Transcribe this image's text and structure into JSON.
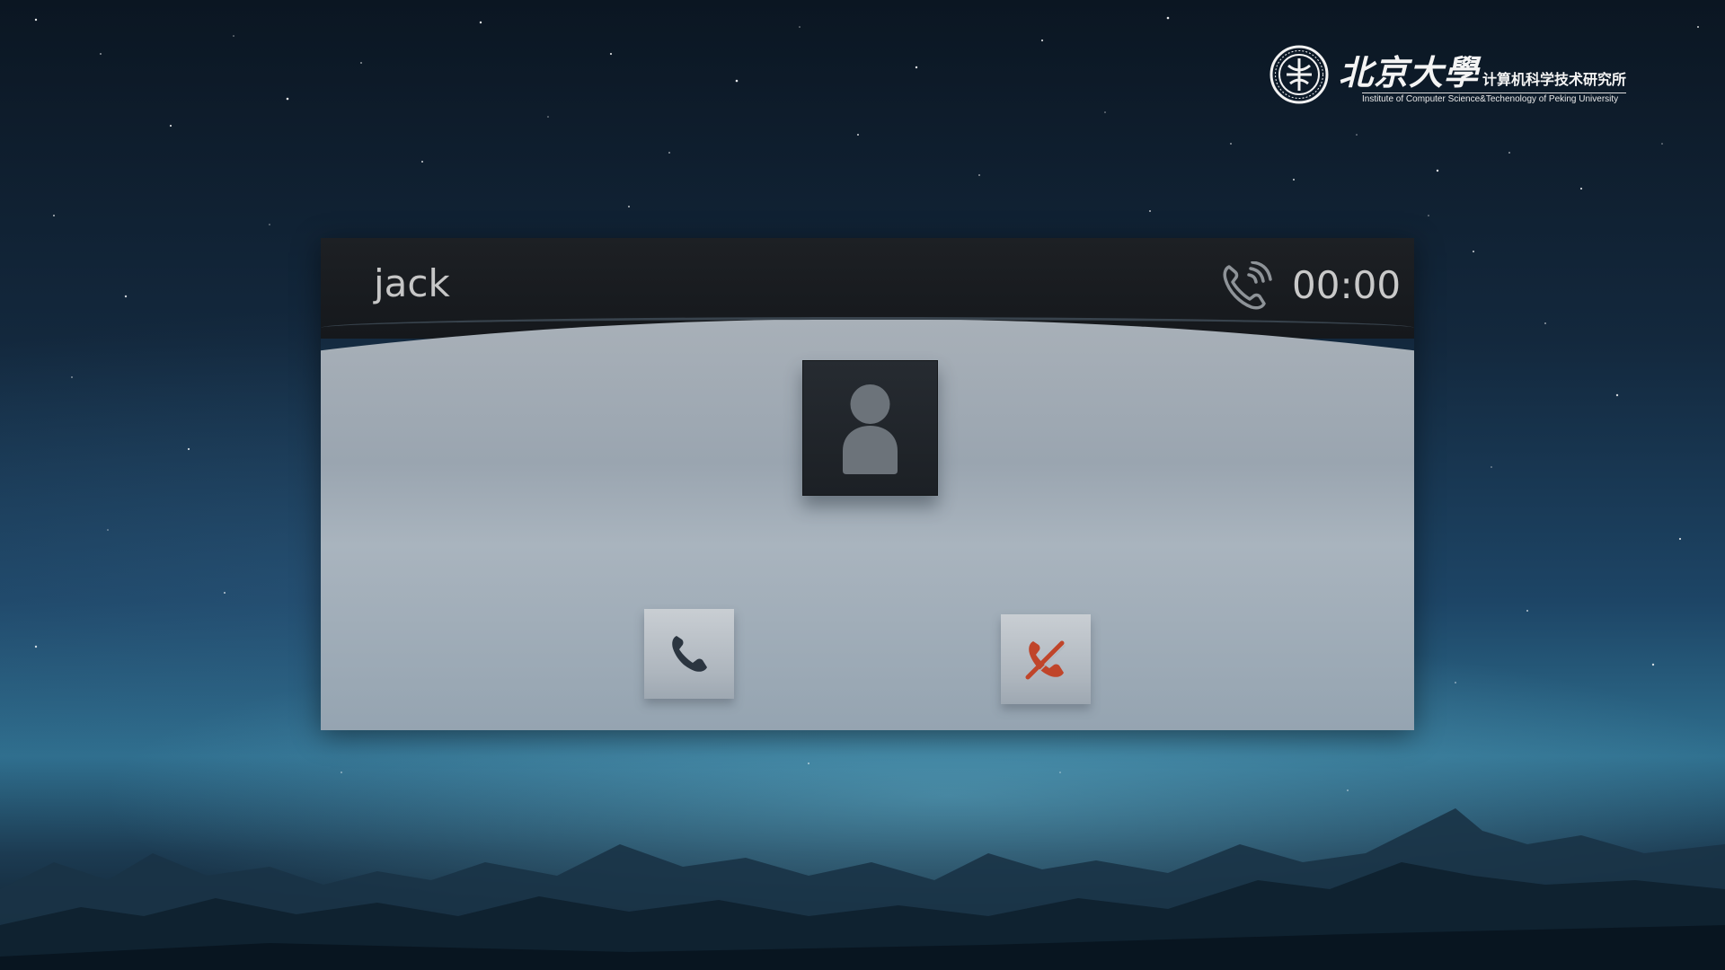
{
  "call": {
    "caller_name": "jack",
    "timer": "00:00",
    "status_icon": "ringing-phone-icon"
  },
  "avatar": {
    "icon": "default-user-avatar-icon"
  },
  "actions": {
    "answer_icon": "phone-answer-icon",
    "decline_icon": "phone-decline-icon",
    "decline_color": "#c0452a",
    "answer_color": "#2b3540"
  },
  "logo": {
    "name_zh": "北京大學",
    "dept_zh": "计算机科学技术研究所",
    "dept_en": "Institute of Computer Science&Techenology of Peking University"
  }
}
